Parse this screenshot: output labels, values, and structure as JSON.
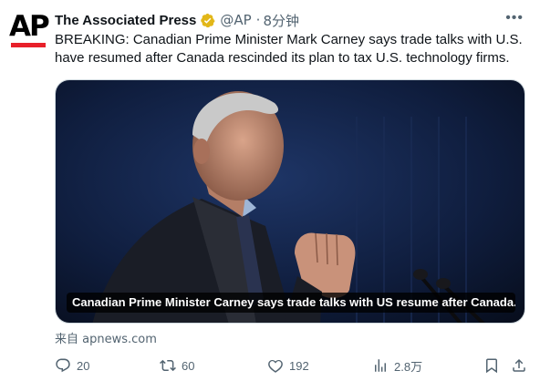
{
  "tweet": {
    "author_name": "The Associated Press",
    "handle": "@AP",
    "separator": "·",
    "time": "8分钟",
    "avatar_text": "AP",
    "text": "BREAKING: Canadian Prime Minister Mark Carney says trade talks with U.S. have resumed after Canada rescinded its plan to tax U.S. technology firms.",
    "media_caption": "Canadian Prime Minister Carney says trade talks with US resume after Canada...",
    "source": "来自 apnews.com"
  },
  "actions": {
    "replies": "20",
    "reposts": "60",
    "likes": "192",
    "views": "2.8万"
  },
  "icons": [
    "verified-badge-icon",
    "more-icon",
    "reply-icon",
    "repost-icon",
    "like-icon",
    "views-icon",
    "bookmark-icon",
    "share-icon"
  ],
  "colors": {
    "verified_gold": "#e2b719",
    "ap_red": "#e8202a",
    "secondary_text": "#536471"
  }
}
